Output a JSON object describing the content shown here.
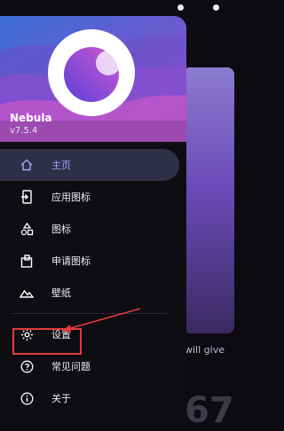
{
  "app": {
    "name": "Nebula",
    "version": "v7.5.4"
  },
  "menu": {
    "items": [
      {
        "label": "主页",
        "icon": "home-icon",
        "active": true
      },
      {
        "label": "应用图标",
        "icon": "apps-icon"
      },
      {
        "label": "图标",
        "icon": "shapes-icon"
      },
      {
        "label": "申请图标",
        "icon": "request-icon"
      },
      {
        "label": "壁纸",
        "icon": "wallpaper-icon"
      }
    ],
    "secondary": [
      {
        "label": "设置",
        "icon": "gear-icon"
      },
      {
        "label": "常见问题",
        "icon": "help-icon"
      },
      {
        "label": "关于",
        "icon": "info-icon"
      }
    ]
  },
  "background": {
    "caption": "will give",
    "number": "67"
  },
  "colors": {
    "accent": "#9fa6ff",
    "highlight": "#e53b3b",
    "drawer_bg": "#0e0d12"
  }
}
